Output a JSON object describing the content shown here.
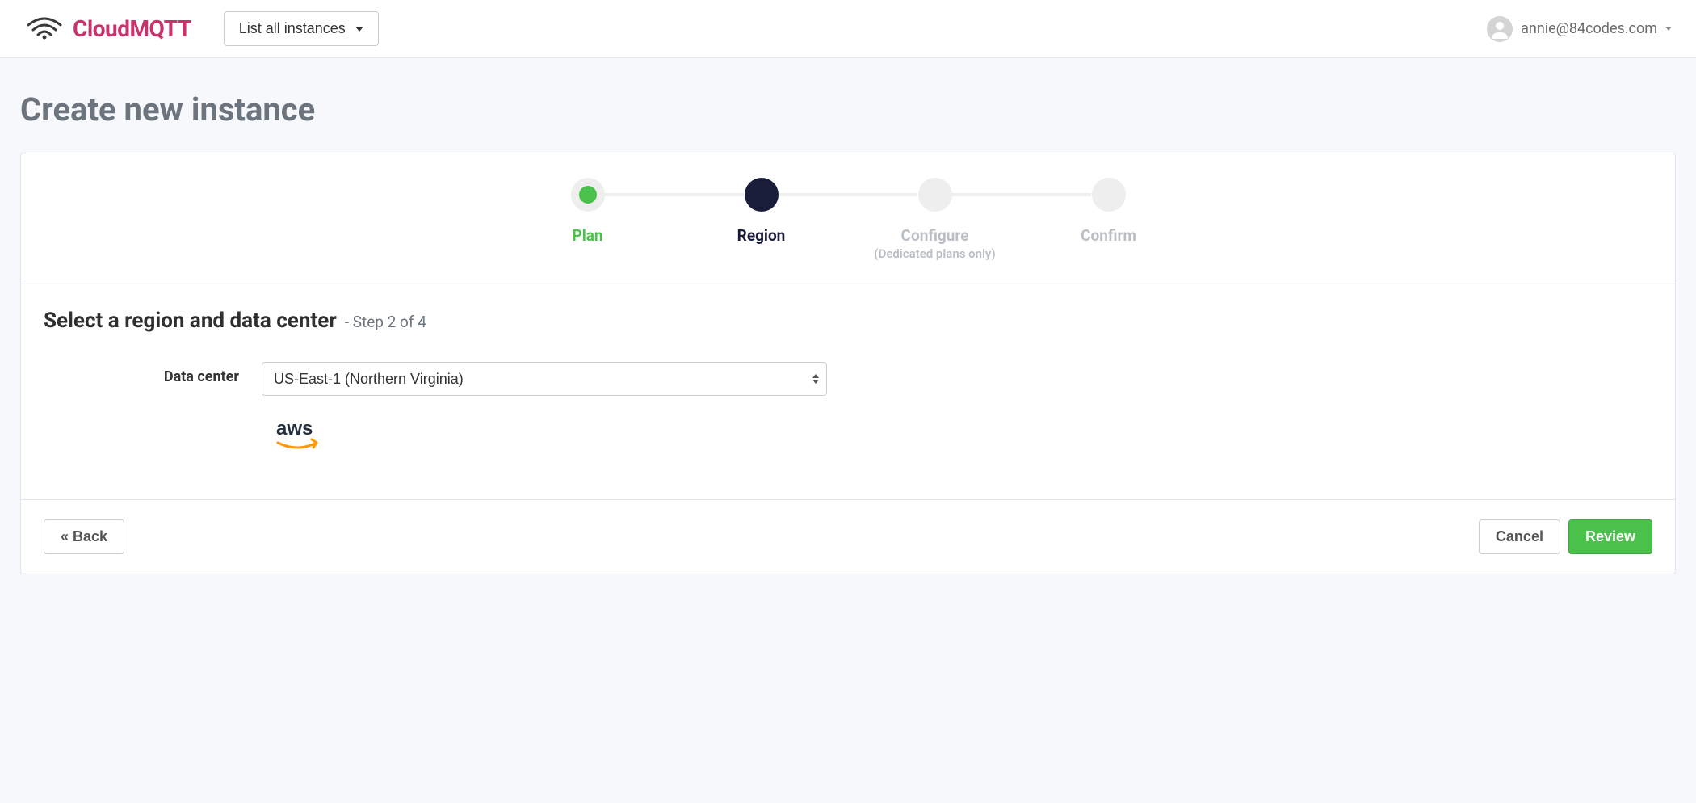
{
  "header": {
    "brand": "CloudMQTT",
    "instances_dropdown_label": "List all instances",
    "user_email": "annie@84codes.com"
  },
  "page": {
    "title": "Create new instance"
  },
  "stepper": {
    "steps": [
      {
        "label": "Plan",
        "state": "completed"
      },
      {
        "label": "Region",
        "state": "active"
      },
      {
        "label": "Configure",
        "sublabel": "(Dedicated plans only)",
        "state": "disabled"
      },
      {
        "label": "Confirm",
        "state": "disabled"
      }
    ]
  },
  "section": {
    "title": "Select a region and data center",
    "subtitle": "- Step 2 of 4"
  },
  "form": {
    "data_center_label": "Data center",
    "data_center_value": "US-East-1 (Northern Virginia)",
    "provider": "aws"
  },
  "actions": {
    "back": "« Back",
    "cancel": "Cancel",
    "review": "Review"
  }
}
